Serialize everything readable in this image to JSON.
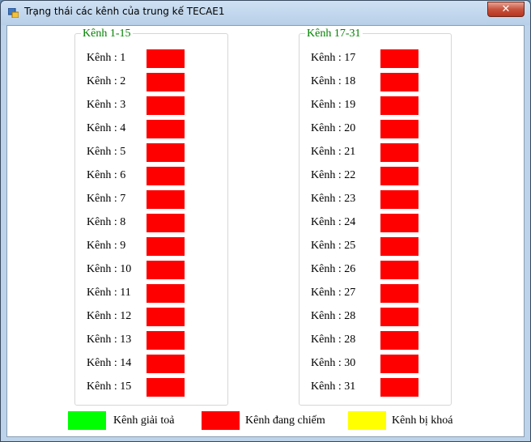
{
  "window": {
    "title": "Trạng thái các kênh của trung kế TECAE1",
    "close_glyph": "✕"
  },
  "colors": {
    "free": "#00ff00",
    "busy": "#ff0000",
    "locked": "#ffff00",
    "group_title": "#008000"
  },
  "group_left": {
    "title": "Kênh 1-15",
    "channels": [
      {
        "label": "Kênh : 1",
        "status": "busy"
      },
      {
        "label": "Kênh : 2",
        "status": "busy"
      },
      {
        "label": "Kênh : 3",
        "status": "busy"
      },
      {
        "label": "Kênh : 4",
        "status": "busy"
      },
      {
        "label": "Kênh : 5",
        "status": "busy"
      },
      {
        "label": "Kênh : 6",
        "status": "busy"
      },
      {
        "label": "Kênh : 7",
        "status": "busy"
      },
      {
        "label": "Kênh : 8",
        "status": "busy"
      },
      {
        "label": "Kênh : 9",
        "status": "busy"
      },
      {
        "label": "Kênh : 10",
        "status": "busy"
      },
      {
        "label": "Kênh : 11",
        "status": "busy"
      },
      {
        "label": "Kênh : 12",
        "status": "busy"
      },
      {
        "label": "Kênh : 13",
        "status": "busy"
      },
      {
        "label": "Kênh : 14",
        "status": "busy"
      },
      {
        "label": "Kênh : 15",
        "status": "busy"
      }
    ]
  },
  "group_right": {
    "title": "Kênh 17-31",
    "channels": [
      {
        "label": "Kênh : 17",
        "status": "busy"
      },
      {
        "label": "Kênh : 18",
        "status": "busy"
      },
      {
        "label": "Kênh : 19",
        "status": "busy"
      },
      {
        "label": "Kênh : 20",
        "status": "busy"
      },
      {
        "label": "Kênh : 21",
        "status": "busy"
      },
      {
        "label": "Kênh : 22",
        "status": "busy"
      },
      {
        "label": "Kênh : 23",
        "status": "busy"
      },
      {
        "label": "Kênh : 24",
        "status": "busy"
      },
      {
        "label": "Kênh : 25",
        "status": "busy"
      },
      {
        "label": "Kênh : 26",
        "status": "busy"
      },
      {
        "label": "Kênh : 27",
        "status": "busy"
      },
      {
        "label": "Kênh : 28",
        "status": "busy"
      },
      {
        "label": "Kênh : 28",
        "status": "busy"
      },
      {
        "label": "Kênh : 30",
        "status": "busy"
      },
      {
        "label": "Kênh : 31",
        "status": "busy"
      }
    ]
  },
  "legend": [
    {
      "label": "Kênh giải toả",
      "status": "free"
    },
    {
      "label": "Kênh đang chiếm",
      "status": "busy"
    },
    {
      "label": "Kênh bị khoá",
      "status": "locked"
    }
  ]
}
